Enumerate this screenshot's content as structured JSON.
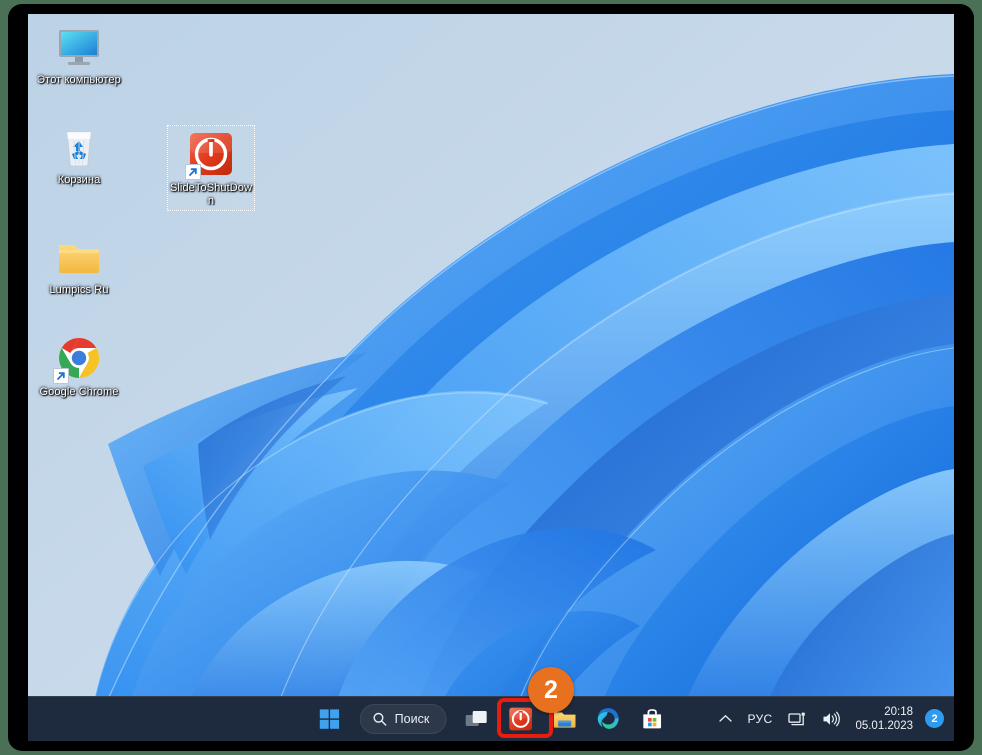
{
  "desktop": {
    "icons": [
      {
        "name": "this-pc",
        "label": "Этот компьютер",
        "icon": "monitor-icon"
      },
      {
        "name": "recycle-bin",
        "label": "Корзина",
        "icon": "recycle-bin-icon"
      },
      {
        "name": "lumpics-folder",
        "label": "Lumpics Ru",
        "icon": "folder-icon"
      },
      {
        "name": "google-chrome",
        "label": "Google Chrome",
        "icon": "chrome-icon"
      },
      {
        "name": "slidetoshutdown",
        "label": "SlideToShutDown",
        "icon": "power-shortcut-icon"
      }
    ]
  },
  "taskbar": {
    "start_label": "Пуск",
    "search": {
      "placeholder": "Поиск",
      "value": "Поиск",
      "icon": "search-icon"
    },
    "buttons": [
      {
        "name": "start-button",
        "label": "Пуск",
        "icon": "windows-logo-icon"
      },
      {
        "name": "task-view-button",
        "label": "Представление задач",
        "icon": "task-view-icon"
      },
      {
        "name": "slidetoshutdown-pinned",
        "label": "SlideToShutDown",
        "icon": "power-button-icon"
      },
      {
        "name": "file-explorer-button",
        "label": "Проводник",
        "icon": "folder-icon"
      },
      {
        "name": "microsoft-edge-button",
        "label": "Microsoft Edge",
        "icon": "edge-icon"
      },
      {
        "name": "microsoft-store-button",
        "label": "Microsoft Store",
        "icon": "store-icon"
      }
    ],
    "tray": {
      "overflow_icon": "chevron-up-icon",
      "language": "РУС",
      "network_icon": "network-icon",
      "volume_icon": "speaker-icon",
      "time": "20:18",
      "date": "05.01.2023",
      "notification_count": "2"
    }
  },
  "annotations": {
    "callout_number": "2",
    "callout_color": "#e8711f",
    "highlight_color": "#e81c0f"
  },
  "colors": {
    "taskbar_bg": "#1e2a3d",
    "accent_blue": "#2f9bef",
    "wallpaper_top": "#b7cde2"
  }
}
